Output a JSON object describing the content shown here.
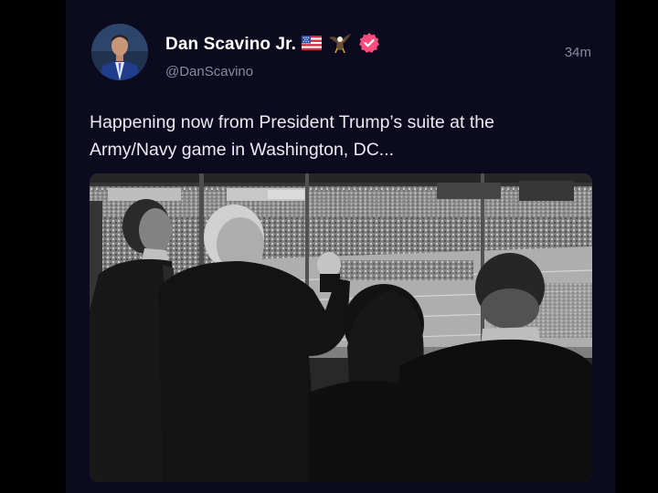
{
  "post": {
    "author": {
      "display_name": "Dan Scavino Jr.",
      "handle": "@DanScavino",
      "badges": [
        "us-flag-icon",
        "eagle-icon",
        "verified-check-icon"
      ],
      "verified_color": "#ff4d7d"
    },
    "timestamp": "34m",
    "text": "Happening now from President Trump’s suite at the Army/Navy game in Washington, DC...",
    "media": {
      "type": "photo",
      "style": "black-and-white"
    }
  },
  "colors": {
    "background": "#0c0a1f",
    "text_primary": "#ffffff",
    "text_secondary": "#8b8aa0"
  }
}
